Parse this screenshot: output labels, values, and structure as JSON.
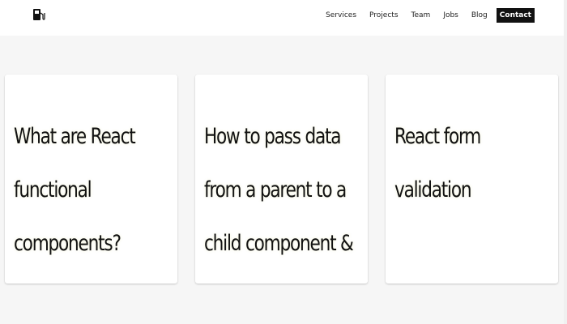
{
  "header": {
    "logo_icon": "fuel-pump-icon",
    "nav": [
      {
        "label": "Services"
      },
      {
        "label": "Projects"
      },
      {
        "label": "Team"
      },
      {
        "label": "Jobs"
      },
      {
        "label": "Blog"
      },
      {
        "label": "Contact"
      }
    ]
  },
  "cards": [
    {
      "title": "What are React functional components?"
    },
    {
      "title": "How to pass data from a parent to a child component & vice versa"
    },
    {
      "title": "React form validation"
    }
  ],
  "colors": {
    "page_background": "#f6f6f6",
    "header_background": "#ffffff",
    "card_background": "#ffffff",
    "contact_button": "#111111"
  }
}
